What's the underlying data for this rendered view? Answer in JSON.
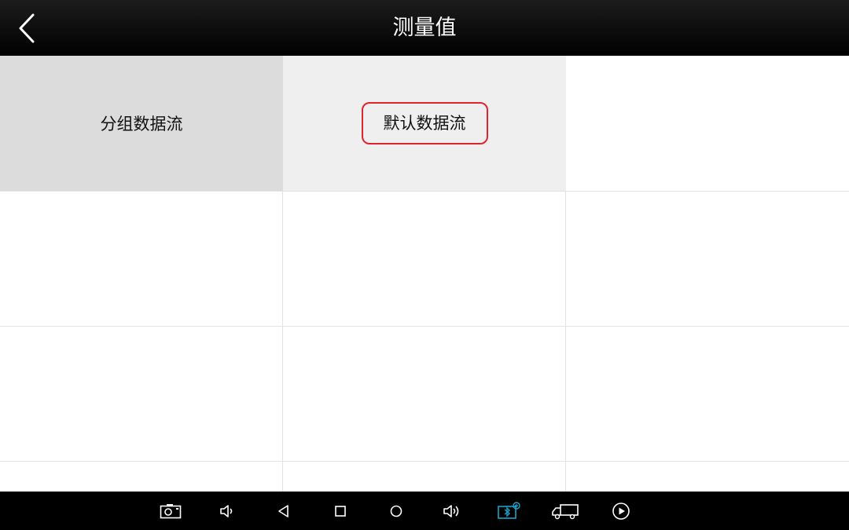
{
  "header": {
    "title": "测量值",
    "back_icon": "chevron-left-icon"
  },
  "grid": {
    "cells": [
      {
        "label": "分组数据流",
        "state": "selected"
      },
      {
        "label": "默认数据流",
        "state": "highlighted"
      },
      {
        "label": "",
        "state": "empty"
      },
      {
        "label": "",
        "state": "empty"
      },
      {
        "label": "",
        "state": "empty"
      },
      {
        "label": "",
        "state": "empty"
      },
      {
        "label": "",
        "state": "empty"
      },
      {
        "label": "",
        "state": "empty"
      },
      {
        "label": "",
        "state": "empty"
      },
      {
        "label": "",
        "state": "empty"
      },
      {
        "label": "",
        "state": "empty"
      },
      {
        "label": "",
        "state": "empty"
      }
    ],
    "highlight_color": "#e0242b"
  },
  "navbar": {
    "icons": [
      "screenshot-icon",
      "volume-down-icon",
      "back-triangle-icon",
      "home-square-icon",
      "recent-circle-icon",
      "volume-up-icon",
      "vci-bluetooth-icon",
      "truck-icon",
      "play-icon"
    ],
    "accent_color": "#1aa3c9"
  }
}
